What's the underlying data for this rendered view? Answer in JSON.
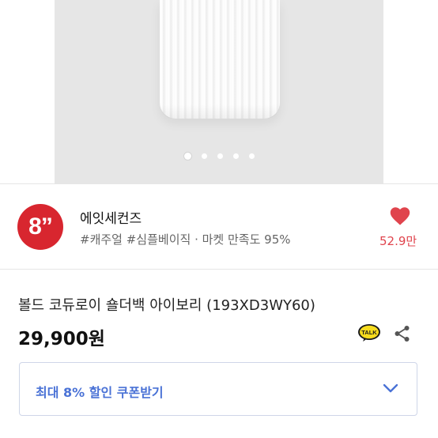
{
  "gallery": {
    "slide_count": 5,
    "active_index": 0
  },
  "seller": {
    "avatar_text": "8”",
    "name": "에잇세컨즈",
    "tags": "#캐주얼 #심플베이직 · 마켓 만족도 95%",
    "likes": "52.9만",
    "accent_color": "#e0444d"
  },
  "product": {
    "title": "볼드 코듀로이 숄더백  아이보리 (193XD3WY60)",
    "price": "29,900원"
  },
  "actions": {
    "talk_icon_text": "TALK"
  },
  "coupon": {
    "label": "최대 8% 할인 쿠폰받기",
    "accent_color": "#4a72d6"
  }
}
